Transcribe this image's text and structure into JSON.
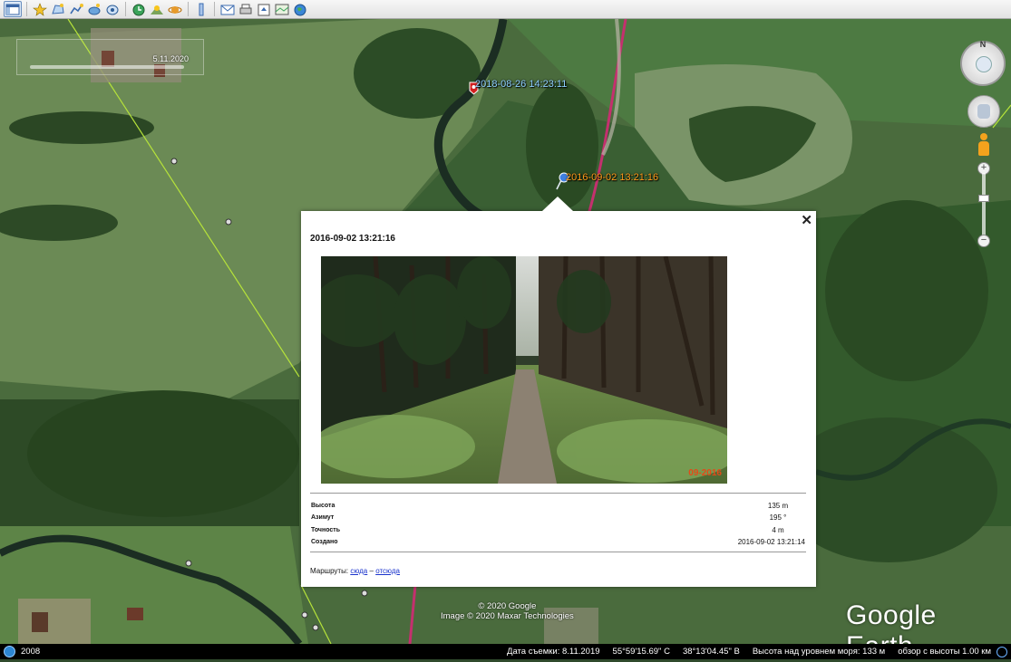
{
  "toolbar": {
    "buttons": [
      "sidebar-toggle",
      "add-placemark",
      "add-polygon",
      "add-path",
      "add-image-overlay",
      "record-tour",
      "historical-imagery",
      "sun",
      "switch-to-sky",
      "ruler",
      "email",
      "print",
      "save-image",
      "view-in-maps",
      "earth-toggle"
    ]
  },
  "map": {
    "time_slider_date": "5.11.2020",
    "placemarks": [
      {
        "label": "2018-08-26 14:23:11",
        "color": "#8fd0ff"
      },
      {
        "label": "2016-09-02 13:21:16",
        "color": "#ff9a1a"
      }
    ],
    "compass_north": "N"
  },
  "balloon": {
    "title": "2016-09-02 13:21:16",
    "photo_stamp": "09-2016",
    "close_label": "✕",
    "properties": [
      {
        "key": "Высота",
        "value": "135 m"
      },
      {
        "key": "Азимут",
        "value": "195 °"
      },
      {
        "key": "Точность",
        "value": "4 m"
      },
      {
        "key": "Создано",
        "value": "2016-09-02 13:21:14"
      }
    ],
    "routes_label": "Маршруты:",
    "routes_to": "сюда",
    "routes_sep": "–",
    "routes_from": "отсюда"
  },
  "branding": {
    "copyright_1": "© 2020 Google",
    "copyright_2": "Image © 2020 Maxar Technologies",
    "logo": "Google Earth"
  },
  "status": {
    "year": "2008",
    "imagery_date": "Дата съемки: 8.11.2019",
    "lat": "55°59'15.69\" С",
    "lon": "38°13'04.45\" В",
    "elevation": "Высота над уровнем моря:   133 м",
    "eye_alt": "обзор с высоты   1.00 км"
  }
}
